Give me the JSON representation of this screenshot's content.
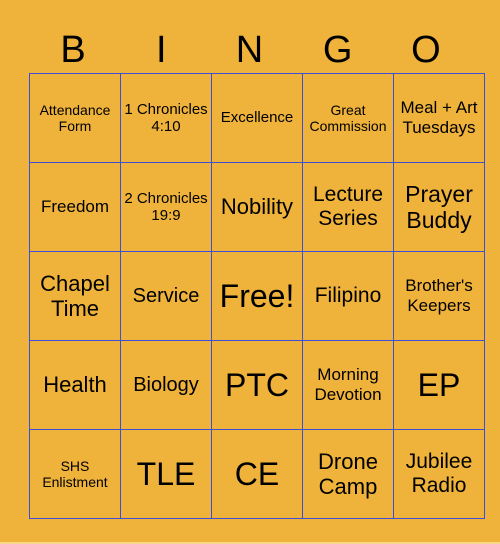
{
  "header": {
    "letters": [
      "B",
      "I",
      "N",
      "G",
      "O"
    ]
  },
  "colors": {
    "background": "#efb33b",
    "grid_line": "#3b4fd8",
    "text": "#000000"
  },
  "rows": [
    [
      "Attendance Form",
      "1 Chronicles 4:10",
      "Excellence",
      "Great Commission",
      "Meal + Art Tuesdays"
    ],
    [
      "Freedom",
      "2 Chronicles 19:9",
      "Nobility",
      "Lecture Series",
      "Prayer Buddy"
    ],
    [
      "Chapel Time",
      "Service",
      "Free!",
      "Filipino",
      "Brother's Keepers"
    ],
    [
      "Health",
      "Biology",
      "PTC",
      "Morning Devotion",
      "EP"
    ],
    [
      "SHS Enlistment",
      "TLE",
      "CE",
      "Drone Camp",
      "Jubilee Radio"
    ]
  ]
}
